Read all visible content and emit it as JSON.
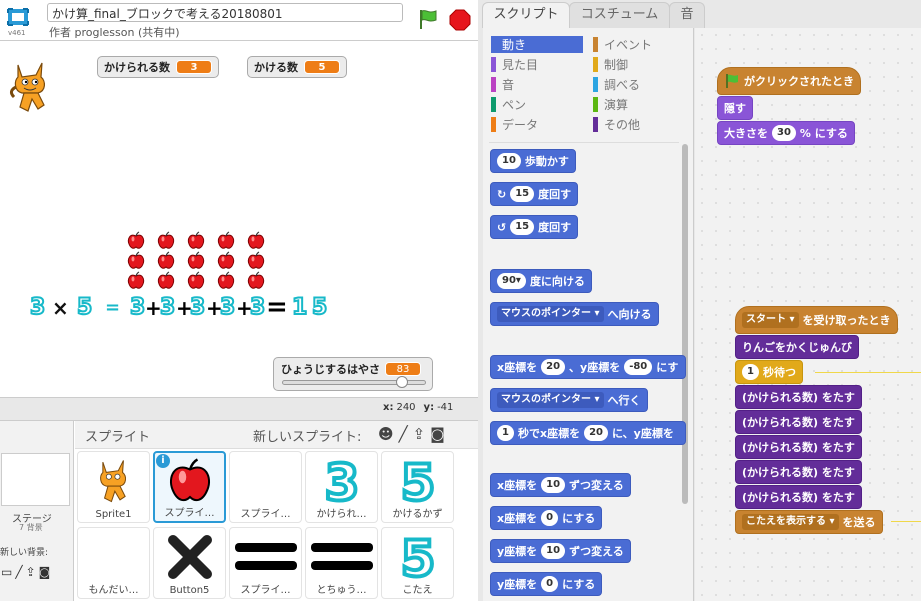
{
  "project": {
    "title": "かけ算_final_ブロックで考える20180801",
    "author": "作者 proglesson (共有中)",
    "version": "v461"
  },
  "stage": {
    "monitors": [
      {
        "label": "かけられる数",
        "value": "3"
      },
      {
        "label": "かける数",
        "value": "5"
      }
    ],
    "equation": [
      "3",
      "×",
      "5",
      "=",
      "3",
      "+",
      "3",
      "+",
      "3",
      "+",
      "3",
      "+",
      "3",
      "=",
      "1",
      "5"
    ],
    "slider": {
      "label": "ひょうじするはやさ",
      "value": "83",
      "fraction": 0.83
    },
    "coords": {
      "x_label": "x:",
      "x": "240",
      "y_label": "y:",
      "y": "-41"
    },
    "apple_grid": {
      "rows": 3,
      "cols": 5
    }
  },
  "sprites": {
    "header": "スプライト",
    "new_sprite_label": "新しいスプライト:",
    "stage_label": "ステージ",
    "stage_sub": "7 背景",
    "new_backdrop_label": "新しい背景:",
    "tiles": [
      {
        "name": "Sprite1",
        "icon": "cat"
      },
      {
        "name": "スプライ…",
        "icon": "apple"
      },
      {
        "name": "スプライ…",
        "icon": "blank"
      },
      {
        "name": "かけられ…",
        "icon": "three"
      },
      {
        "name": "かけるかず",
        "icon": "five"
      },
      {
        "name": "もんだい…",
        "icon": "blank"
      },
      {
        "name": "Button5",
        "icon": "cross"
      },
      {
        "name": "スプライ…",
        "icon": "equals"
      },
      {
        "name": "とちゅう…",
        "icon": "equals"
      },
      {
        "name": "こたえ",
        "icon": "five"
      }
    ]
  },
  "tabs": [
    "スクリプト",
    "コスチューム",
    "音"
  ],
  "categories": [
    {
      "label": "動き",
      "color": "#4a6cd4"
    },
    {
      "label": "見た目",
      "color": "#8a55d7"
    },
    {
      "label": "音",
      "color": "#bb42c3"
    },
    {
      "label": "ペン",
      "color": "#0e9a6c"
    },
    {
      "label": "データ",
      "color": "#ee7d16"
    },
    {
      "label": "イベント",
      "color": "#c88330"
    },
    {
      "label": "制御",
      "color": "#e1a91a"
    },
    {
      "label": "調べる",
      "color": "#2ca5e2"
    },
    {
      "label": "演算",
      "color": "#5cb712"
    },
    {
      "label": "その他",
      "color": "#632d99"
    }
  ],
  "palette": {
    "move": {
      "value": "10",
      "text": "歩動かす"
    },
    "turn_right": {
      "value": "15",
      "text": "度回す"
    },
    "turn_left": {
      "value": "15",
      "text": "度回す"
    },
    "point_dir": {
      "value": "90▾",
      "text": "度に向ける"
    },
    "point_toward": {
      "dropdown": "マウスのポインター ▾",
      "text": "へ向ける"
    },
    "goto_xy": {
      "t1": "x座標を",
      "v1": "20",
      "t2": "、y座標を",
      "v2": "-80",
      "t3": "にす"
    },
    "goto": {
      "dropdown": "マウスのポインター ▾",
      "text": "へ行く"
    },
    "glide": {
      "v1": "1",
      "t1": "秒でx座標を",
      "v2": "20",
      "t2": "に、y座標を"
    },
    "change_x": {
      "t1": "x座標を",
      "value": "10",
      "t2": "ずつ変える"
    },
    "set_x": {
      "t1": "x座標を",
      "value": "0",
      "t2": "にする"
    },
    "change_y": {
      "t1": "y座標を",
      "value": "10",
      "t2": "ずつ変える"
    },
    "set_y": {
      "t1": "y座標を",
      "value": "0",
      "t2": "にする"
    }
  },
  "scripts": {
    "s1_hat": "がクリックされたとき",
    "s1_hide": "隠す",
    "s1_size_t1": "大きさを",
    "s1_size_v": "30",
    "s1_size_t2": "% にする",
    "s2_hat_dd": "スタート ▾",
    "s2_hat_t": "を受け取ったとき",
    "s2_custom": "りんごをかくじゅんび",
    "s2_wait_v": "1",
    "s2_wait_t": "秒待つ",
    "s2_add": "(かけられる数) をたす",
    "s2_broadcast_dd": "こたえを表示する ▾",
    "s2_broadcast_t": "を送る"
  }
}
